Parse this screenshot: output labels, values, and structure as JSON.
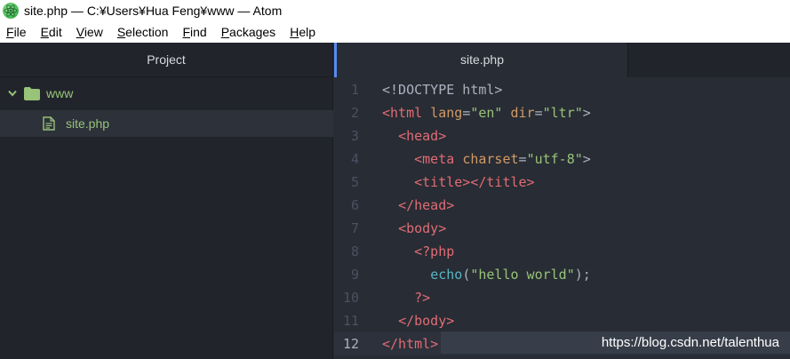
{
  "window": {
    "title": "site.php — C:¥Users¥Hua Feng¥www — Atom"
  },
  "menu": [
    {
      "accel": "F",
      "rest": "ile"
    },
    {
      "accel": "E",
      "rest": "dit"
    },
    {
      "accel": "V",
      "rest": "iew"
    },
    {
      "accel": "S",
      "rest": "election"
    },
    {
      "accel": "F",
      "rest": "ind"
    },
    {
      "accel": "P",
      "rest": "ackages"
    },
    {
      "accel": "H",
      "rest": "elp"
    }
  ],
  "sidebar": {
    "header": "Project",
    "folder": "www",
    "file": "site.php"
  },
  "tabs": {
    "active": "site.php"
  },
  "editor": {
    "cursor_line": 12,
    "lines": [
      {
        "n": "1",
        "tokens": [
          [
            "<!DOCTYPE html>",
            "doc"
          ]
        ]
      },
      {
        "n": "2",
        "tokens": [
          [
            "<",
            "tag"
          ],
          [
            "html",
            "tag"
          ],
          [
            " ",
            ""
          ],
          [
            "lang",
            "attr"
          ],
          [
            "=",
            ""
          ],
          [
            "\"en\"",
            "str"
          ],
          [
            " ",
            ""
          ],
          [
            "dir",
            "attr"
          ],
          [
            "=",
            ""
          ],
          [
            "\"ltr\"",
            "str"
          ],
          [
            ">",
            "plain"
          ]
        ]
      },
      {
        "n": "3",
        "tokens": [
          [
            "  ",
            ""
          ],
          [
            "<head>",
            "tag"
          ]
        ]
      },
      {
        "n": "4",
        "tokens": [
          [
            "    ",
            ""
          ],
          [
            "<meta",
            "tag"
          ],
          [
            " ",
            ""
          ],
          [
            "charset",
            "attr"
          ],
          [
            "=",
            ""
          ],
          [
            "\"utf-8\"",
            "str"
          ],
          [
            ">",
            "plain"
          ]
        ]
      },
      {
        "n": "5",
        "tokens": [
          [
            "    ",
            ""
          ],
          [
            "<title></title>",
            "tag"
          ]
        ]
      },
      {
        "n": "6",
        "tokens": [
          [
            "  ",
            ""
          ],
          [
            "</head>",
            "tag"
          ]
        ]
      },
      {
        "n": "7",
        "tokens": [
          [
            "  ",
            ""
          ],
          [
            "<body>",
            "tag"
          ]
        ]
      },
      {
        "n": "8",
        "tokens": [
          [
            "    ",
            ""
          ],
          [
            "<?php",
            "php"
          ]
        ]
      },
      {
        "n": "9",
        "tokens": [
          [
            "      ",
            ""
          ],
          [
            "echo",
            "func"
          ],
          [
            "(",
            ""
          ],
          [
            "\"hello world\"",
            "str"
          ],
          [
            ");",
            ""
          ]
        ]
      },
      {
        "n": "10",
        "tokens": [
          [
            "    ",
            ""
          ],
          [
            "?>",
            "php"
          ]
        ]
      },
      {
        "n": "11",
        "tokens": [
          [
            "  ",
            ""
          ],
          [
            "</body>",
            "tag"
          ]
        ]
      },
      {
        "n": "12",
        "tokens": [
          [
            "</html>",
            "tag"
          ]
        ]
      }
    ]
  },
  "watermark": "https://blog.csdn.net/talenthua"
}
